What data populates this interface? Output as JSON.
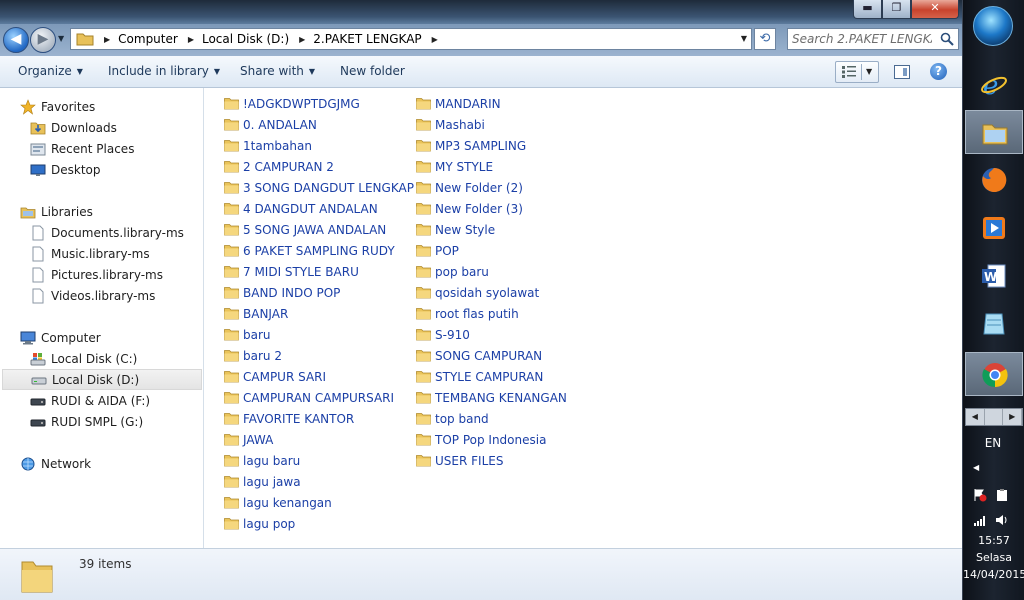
{
  "window": {
    "controls": {
      "minimize": "▬",
      "maximize": "❐",
      "close": "✕"
    }
  },
  "address": {
    "crumbs": [
      "Computer",
      "Local Disk (D:)",
      "2.PAKET LENGKAP"
    ],
    "search_placeholder": "Search 2.PAKET LENGKAP"
  },
  "toolbar": {
    "organize": "Organize",
    "include_in_library": "Include in library",
    "share_with": "Share with",
    "new_folder": "New folder"
  },
  "nav": {
    "favorites": "Favorites",
    "favorites_items": [
      "Downloads",
      "Recent Places",
      "Desktop"
    ],
    "libraries": "Libraries",
    "libraries_items": [
      "Documents.library-ms",
      "Music.library-ms",
      "Pictures.library-ms",
      "Videos.library-ms"
    ],
    "computer": "Computer",
    "computer_items": [
      "Local Disk (C:)",
      "Local Disk (D:)",
      "RUDI & AIDA (F:)",
      "RUDI SMPL (G:)"
    ],
    "network": "Network"
  },
  "files": {
    "column1": [
      "!ADGKDWPTDGJMG",
      "0. ANDALAN",
      "1tambahan",
      "2 CAMPURAN 2",
      "3 SONG DANGDUT LENGKAP",
      "4 DANGDUT ANDALAN",
      "5 SONG JAWA ANDALAN",
      "6 PAKET SAMPLING RUDY",
      "7 MIDI STYLE BARU",
      "BAND INDO POP",
      "BANJAR",
      "baru",
      "baru 2",
      "CAMPUR SARI",
      "CAMPURAN CAMPURSARI",
      "FAVORITE KANTOR",
      "JAWA",
      "lagu baru",
      "lagu jawa",
      "lagu kenangan",
      "lagu pop"
    ],
    "column2": [
      "MANDARIN",
      "Mashabi",
      "MP3 SAMPLING",
      "MY STYLE",
      "New Folder (2)",
      "New Folder (3)",
      "New Style",
      "POP",
      "pop baru",
      "qosidah syolawat",
      "root flas putih",
      "S-910",
      "SONG CAMPURAN",
      "STYLE CAMPURAN",
      "TEMBANG KENANGAN",
      "top band",
      "TOP Pop Indonesia",
      "USER FILES"
    ]
  },
  "status": {
    "item_count": "39 items"
  },
  "taskbar": {
    "apps": [
      "internet-explorer-icon",
      "windows-explorer-icon",
      "firefox-icon",
      "media-player-icon",
      "word-icon",
      "notepad-icon",
      "chrome-icon"
    ],
    "active_app": "chrome-icon",
    "language": "EN",
    "time": "15:57",
    "day": "Selasa",
    "date": "14/04/2015"
  },
  "colors": {
    "link_text": "#1b3fa6",
    "folder": "#f2c94c",
    "nav_selected": "#e6e6e6"
  }
}
